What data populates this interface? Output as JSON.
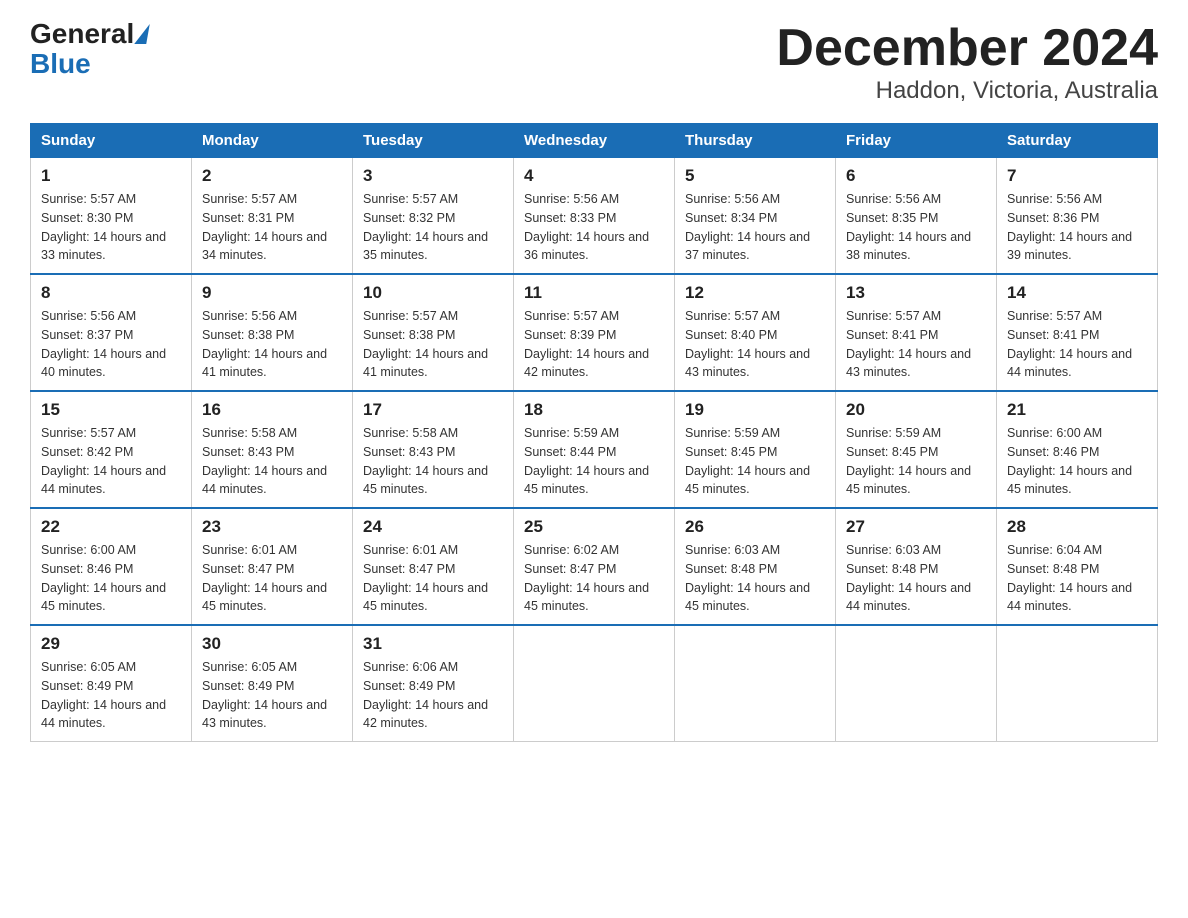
{
  "logo": {
    "general": "General",
    "blue": "Blue"
  },
  "title": "December 2024",
  "subtitle": "Haddon, Victoria, Australia",
  "days": [
    "Sunday",
    "Monday",
    "Tuesday",
    "Wednesday",
    "Thursday",
    "Friday",
    "Saturday"
  ],
  "weeks": [
    [
      {
        "num": "1",
        "sunrise": "5:57 AM",
        "sunset": "8:30 PM",
        "daylight": "14 hours and 33 minutes."
      },
      {
        "num": "2",
        "sunrise": "5:57 AM",
        "sunset": "8:31 PM",
        "daylight": "14 hours and 34 minutes."
      },
      {
        "num": "3",
        "sunrise": "5:57 AM",
        "sunset": "8:32 PM",
        "daylight": "14 hours and 35 minutes."
      },
      {
        "num": "4",
        "sunrise": "5:56 AM",
        "sunset": "8:33 PM",
        "daylight": "14 hours and 36 minutes."
      },
      {
        "num": "5",
        "sunrise": "5:56 AM",
        "sunset": "8:34 PM",
        "daylight": "14 hours and 37 minutes."
      },
      {
        "num": "6",
        "sunrise": "5:56 AM",
        "sunset": "8:35 PM",
        "daylight": "14 hours and 38 minutes."
      },
      {
        "num": "7",
        "sunrise": "5:56 AM",
        "sunset": "8:36 PM",
        "daylight": "14 hours and 39 minutes."
      }
    ],
    [
      {
        "num": "8",
        "sunrise": "5:56 AM",
        "sunset": "8:37 PM",
        "daylight": "14 hours and 40 minutes."
      },
      {
        "num": "9",
        "sunrise": "5:56 AM",
        "sunset": "8:38 PM",
        "daylight": "14 hours and 41 minutes."
      },
      {
        "num": "10",
        "sunrise": "5:57 AM",
        "sunset": "8:38 PM",
        "daylight": "14 hours and 41 minutes."
      },
      {
        "num": "11",
        "sunrise": "5:57 AM",
        "sunset": "8:39 PM",
        "daylight": "14 hours and 42 minutes."
      },
      {
        "num": "12",
        "sunrise": "5:57 AM",
        "sunset": "8:40 PM",
        "daylight": "14 hours and 43 minutes."
      },
      {
        "num": "13",
        "sunrise": "5:57 AM",
        "sunset": "8:41 PM",
        "daylight": "14 hours and 43 minutes."
      },
      {
        "num": "14",
        "sunrise": "5:57 AM",
        "sunset": "8:41 PM",
        "daylight": "14 hours and 44 minutes."
      }
    ],
    [
      {
        "num": "15",
        "sunrise": "5:57 AM",
        "sunset": "8:42 PM",
        "daylight": "14 hours and 44 minutes."
      },
      {
        "num": "16",
        "sunrise": "5:58 AM",
        "sunset": "8:43 PM",
        "daylight": "14 hours and 44 minutes."
      },
      {
        "num": "17",
        "sunrise": "5:58 AM",
        "sunset": "8:43 PM",
        "daylight": "14 hours and 45 minutes."
      },
      {
        "num": "18",
        "sunrise": "5:59 AM",
        "sunset": "8:44 PM",
        "daylight": "14 hours and 45 minutes."
      },
      {
        "num": "19",
        "sunrise": "5:59 AM",
        "sunset": "8:45 PM",
        "daylight": "14 hours and 45 minutes."
      },
      {
        "num": "20",
        "sunrise": "5:59 AM",
        "sunset": "8:45 PM",
        "daylight": "14 hours and 45 minutes."
      },
      {
        "num": "21",
        "sunrise": "6:00 AM",
        "sunset": "8:46 PM",
        "daylight": "14 hours and 45 minutes."
      }
    ],
    [
      {
        "num": "22",
        "sunrise": "6:00 AM",
        "sunset": "8:46 PM",
        "daylight": "14 hours and 45 minutes."
      },
      {
        "num": "23",
        "sunrise": "6:01 AM",
        "sunset": "8:47 PM",
        "daylight": "14 hours and 45 minutes."
      },
      {
        "num": "24",
        "sunrise": "6:01 AM",
        "sunset": "8:47 PM",
        "daylight": "14 hours and 45 minutes."
      },
      {
        "num": "25",
        "sunrise": "6:02 AM",
        "sunset": "8:47 PM",
        "daylight": "14 hours and 45 minutes."
      },
      {
        "num": "26",
        "sunrise": "6:03 AM",
        "sunset": "8:48 PM",
        "daylight": "14 hours and 45 minutes."
      },
      {
        "num": "27",
        "sunrise": "6:03 AM",
        "sunset": "8:48 PM",
        "daylight": "14 hours and 44 minutes."
      },
      {
        "num": "28",
        "sunrise": "6:04 AM",
        "sunset": "8:48 PM",
        "daylight": "14 hours and 44 minutes."
      }
    ],
    [
      {
        "num": "29",
        "sunrise": "6:05 AM",
        "sunset": "8:49 PM",
        "daylight": "14 hours and 44 minutes."
      },
      {
        "num": "30",
        "sunrise": "6:05 AM",
        "sunset": "8:49 PM",
        "daylight": "14 hours and 43 minutes."
      },
      {
        "num": "31",
        "sunrise": "6:06 AM",
        "sunset": "8:49 PM",
        "daylight": "14 hours and 42 minutes."
      },
      null,
      null,
      null,
      null
    ]
  ]
}
